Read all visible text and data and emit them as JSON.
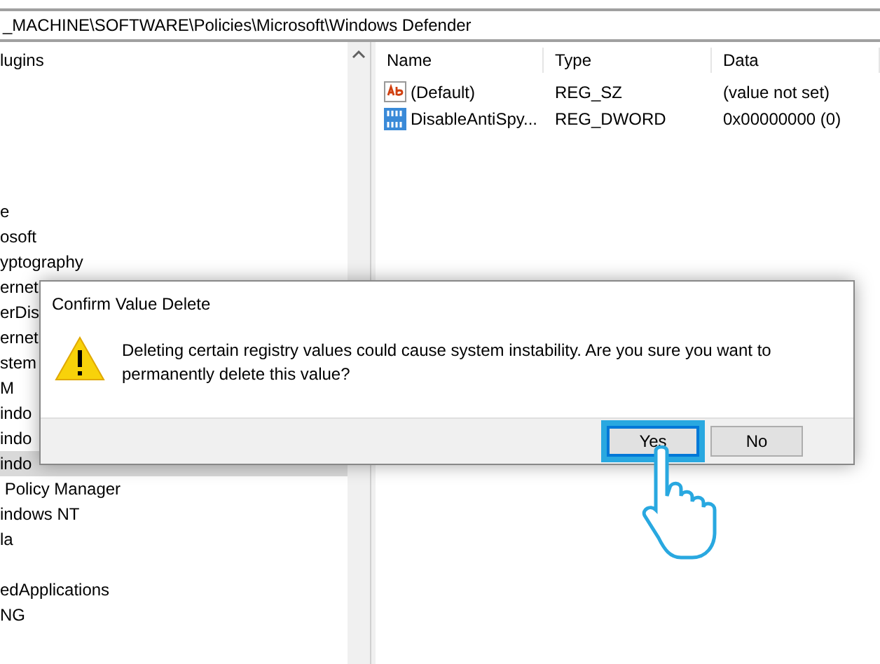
{
  "address_bar": {
    "path": "_MACHINE\\SOFTWARE\\Policies\\Microsoft\\Windows Defender"
  },
  "tree": {
    "items": [
      {
        "label": "lugins",
        "selected": false
      },
      {
        "selected": false
      },
      {
        "selected": false
      },
      {
        "selected": false
      },
      {
        "selected": false
      },
      {
        "selected": false
      },
      {
        "label": "e",
        "selected": false
      },
      {
        "label": "osoft",
        "selected": false
      },
      {
        "label": "yptography",
        "selected": false
      },
      {
        "label": "ernet",
        "selected": false
      },
      {
        "label": "erDis",
        "selected": false
      },
      {
        "label": "ernet",
        "selected": false
      },
      {
        "label": "stem",
        "selected": false
      },
      {
        "label": "M",
        "selected": false
      },
      {
        "label": "indo",
        "selected": false
      },
      {
        "label": "indo",
        "selected": false
      },
      {
        "label": "indo",
        "selected": true
      },
      {
        "label": " Policy Manager",
        "selected": false
      },
      {
        "label": "indows NT",
        "selected": false
      },
      {
        "label": "la",
        "selected": false
      },
      {
        "selected": false
      },
      {
        "label": "edApplications",
        "selected": false
      },
      {
        "label": "NG",
        "selected": false
      }
    ]
  },
  "values": {
    "columns": [
      "Name",
      "Type",
      "Data"
    ],
    "rows": [
      {
        "kind": "string",
        "name": "(Default)",
        "type": "REG_SZ",
        "data": "(value not set)"
      },
      {
        "kind": "binary",
        "name": "DisableAntiSpy...",
        "type": "REG_DWORD",
        "data": "0x00000000 (0)"
      }
    ]
  },
  "dialog": {
    "title": "Confirm Value Delete",
    "message": "Deleting certain registry values could cause system instability. Are you sure you want to permanently delete this value?",
    "buttons": [
      {
        "label": "Yes",
        "selected": true
      },
      {
        "label": "No",
        "selected": false
      }
    ]
  }
}
